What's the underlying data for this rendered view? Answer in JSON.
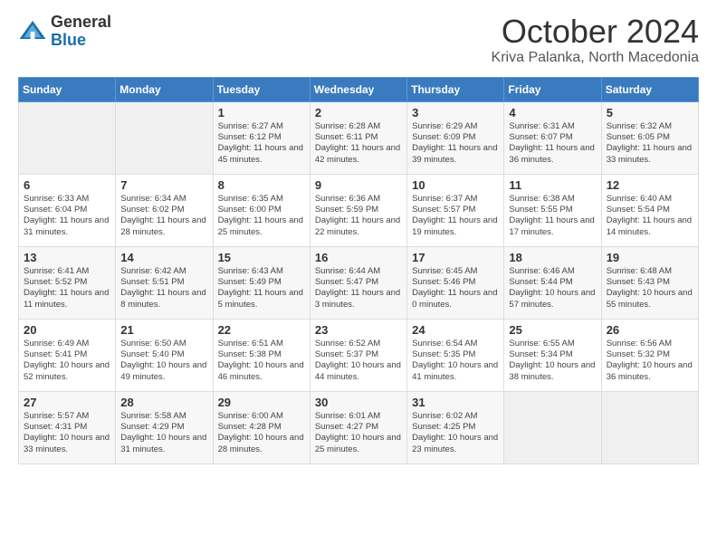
{
  "logo": {
    "general": "General",
    "blue": "Blue"
  },
  "header": {
    "month": "October 2024",
    "location": "Kriva Palanka, North Macedonia"
  },
  "weekdays": [
    "Sunday",
    "Monday",
    "Tuesday",
    "Wednesday",
    "Thursday",
    "Friday",
    "Saturday"
  ],
  "weeks": [
    [
      {
        "day": "",
        "sunrise": "",
        "sunset": "",
        "daylight": ""
      },
      {
        "day": "",
        "sunrise": "",
        "sunset": "",
        "daylight": ""
      },
      {
        "day": "1",
        "sunrise": "Sunrise: 6:27 AM",
        "sunset": "Sunset: 6:12 PM",
        "daylight": "Daylight: 11 hours and 45 minutes."
      },
      {
        "day": "2",
        "sunrise": "Sunrise: 6:28 AM",
        "sunset": "Sunset: 6:11 PM",
        "daylight": "Daylight: 11 hours and 42 minutes."
      },
      {
        "day": "3",
        "sunrise": "Sunrise: 6:29 AM",
        "sunset": "Sunset: 6:09 PM",
        "daylight": "Daylight: 11 hours and 39 minutes."
      },
      {
        "day": "4",
        "sunrise": "Sunrise: 6:31 AM",
        "sunset": "Sunset: 6:07 PM",
        "daylight": "Daylight: 11 hours and 36 minutes."
      },
      {
        "day": "5",
        "sunrise": "Sunrise: 6:32 AM",
        "sunset": "Sunset: 6:05 PM",
        "daylight": "Daylight: 11 hours and 33 minutes."
      }
    ],
    [
      {
        "day": "6",
        "sunrise": "Sunrise: 6:33 AM",
        "sunset": "Sunset: 6:04 PM",
        "daylight": "Daylight: 11 hours and 31 minutes."
      },
      {
        "day": "7",
        "sunrise": "Sunrise: 6:34 AM",
        "sunset": "Sunset: 6:02 PM",
        "daylight": "Daylight: 11 hours and 28 minutes."
      },
      {
        "day": "8",
        "sunrise": "Sunrise: 6:35 AM",
        "sunset": "Sunset: 6:00 PM",
        "daylight": "Daylight: 11 hours and 25 minutes."
      },
      {
        "day": "9",
        "sunrise": "Sunrise: 6:36 AM",
        "sunset": "Sunset: 5:59 PM",
        "daylight": "Daylight: 11 hours and 22 minutes."
      },
      {
        "day": "10",
        "sunrise": "Sunrise: 6:37 AM",
        "sunset": "Sunset: 5:57 PM",
        "daylight": "Daylight: 11 hours and 19 minutes."
      },
      {
        "day": "11",
        "sunrise": "Sunrise: 6:38 AM",
        "sunset": "Sunset: 5:55 PM",
        "daylight": "Daylight: 11 hours and 17 minutes."
      },
      {
        "day": "12",
        "sunrise": "Sunrise: 6:40 AM",
        "sunset": "Sunset: 5:54 PM",
        "daylight": "Daylight: 11 hours and 14 minutes."
      }
    ],
    [
      {
        "day": "13",
        "sunrise": "Sunrise: 6:41 AM",
        "sunset": "Sunset: 5:52 PM",
        "daylight": "Daylight: 11 hours and 11 minutes."
      },
      {
        "day": "14",
        "sunrise": "Sunrise: 6:42 AM",
        "sunset": "Sunset: 5:51 PM",
        "daylight": "Daylight: 11 hours and 8 minutes."
      },
      {
        "day": "15",
        "sunrise": "Sunrise: 6:43 AM",
        "sunset": "Sunset: 5:49 PM",
        "daylight": "Daylight: 11 hours and 5 minutes."
      },
      {
        "day": "16",
        "sunrise": "Sunrise: 6:44 AM",
        "sunset": "Sunset: 5:47 PM",
        "daylight": "Daylight: 11 hours and 3 minutes."
      },
      {
        "day": "17",
        "sunrise": "Sunrise: 6:45 AM",
        "sunset": "Sunset: 5:46 PM",
        "daylight": "Daylight: 11 hours and 0 minutes."
      },
      {
        "day": "18",
        "sunrise": "Sunrise: 6:46 AM",
        "sunset": "Sunset: 5:44 PM",
        "daylight": "Daylight: 10 hours and 57 minutes."
      },
      {
        "day": "19",
        "sunrise": "Sunrise: 6:48 AM",
        "sunset": "Sunset: 5:43 PM",
        "daylight": "Daylight: 10 hours and 55 minutes."
      }
    ],
    [
      {
        "day": "20",
        "sunrise": "Sunrise: 6:49 AM",
        "sunset": "Sunset: 5:41 PM",
        "daylight": "Daylight: 10 hours and 52 minutes."
      },
      {
        "day": "21",
        "sunrise": "Sunrise: 6:50 AM",
        "sunset": "Sunset: 5:40 PM",
        "daylight": "Daylight: 10 hours and 49 minutes."
      },
      {
        "day": "22",
        "sunrise": "Sunrise: 6:51 AM",
        "sunset": "Sunset: 5:38 PM",
        "daylight": "Daylight: 10 hours and 46 minutes."
      },
      {
        "day": "23",
        "sunrise": "Sunrise: 6:52 AM",
        "sunset": "Sunset: 5:37 PM",
        "daylight": "Daylight: 10 hours and 44 minutes."
      },
      {
        "day": "24",
        "sunrise": "Sunrise: 6:54 AM",
        "sunset": "Sunset: 5:35 PM",
        "daylight": "Daylight: 10 hours and 41 minutes."
      },
      {
        "day": "25",
        "sunrise": "Sunrise: 6:55 AM",
        "sunset": "Sunset: 5:34 PM",
        "daylight": "Daylight: 10 hours and 38 minutes."
      },
      {
        "day": "26",
        "sunrise": "Sunrise: 6:56 AM",
        "sunset": "Sunset: 5:32 PM",
        "daylight": "Daylight: 10 hours and 36 minutes."
      }
    ],
    [
      {
        "day": "27",
        "sunrise": "Sunrise: 5:57 AM",
        "sunset": "Sunset: 4:31 PM",
        "daylight": "Daylight: 10 hours and 33 minutes."
      },
      {
        "day": "28",
        "sunrise": "Sunrise: 5:58 AM",
        "sunset": "Sunset: 4:29 PM",
        "daylight": "Daylight: 10 hours and 31 minutes."
      },
      {
        "day": "29",
        "sunrise": "Sunrise: 6:00 AM",
        "sunset": "Sunset: 4:28 PM",
        "daylight": "Daylight: 10 hours and 28 minutes."
      },
      {
        "day": "30",
        "sunrise": "Sunrise: 6:01 AM",
        "sunset": "Sunset: 4:27 PM",
        "daylight": "Daylight: 10 hours and 25 minutes."
      },
      {
        "day": "31",
        "sunrise": "Sunrise: 6:02 AM",
        "sunset": "Sunset: 4:25 PM",
        "daylight": "Daylight: 10 hours and 23 minutes."
      },
      {
        "day": "",
        "sunrise": "",
        "sunset": "",
        "daylight": ""
      },
      {
        "day": "",
        "sunrise": "",
        "sunset": "",
        "daylight": ""
      }
    ]
  ]
}
